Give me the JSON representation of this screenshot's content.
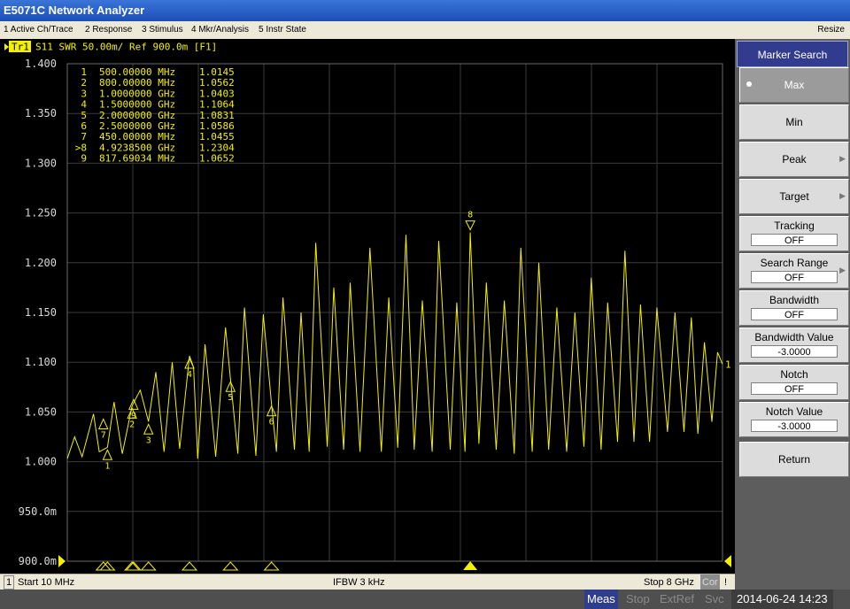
{
  "window": {
    "title": "E5071C Network Analyzer",
    "resize_label": "Resize"
  },
  "menu": [
    "1 Active Ch/Trace",
    "2 Response",
    "3 Stimulus",
    "4 Mkr/Analysis",
    "5 Instr State"
  ],
  "trace": {
    "badge": "Tr1",
    "header": "S11  SWR 50.00m/ Ref 900.0m [F1]",
    "color": "#f4f000",
    "ref_value": 0.9,
    "ref_end_label": "1"
  },
  "chart_data": {
    "type": "line",
    "x_range_mhz": [
      10,
      8000
    ],
    "ylim": [
      0.9,
      1.4
    ],
    "y_ticks": [
      {
        "value": 1.4,
        "label": "1.400"
      },
      {
        "value": 1.35,
        "label": "1.350"
      },
      {
        "value": 1.3,
        "label": "1.300"
      },
      {
        "value": 1.25,
        "label": "1.250"
      },
      {
        "value": 1.2,
        "label": "1.200"
      },
      {
        "value": 1.15,
        "label": "1.150"
      },
      {
        "value": 1.1,
        "label": "1.100"
      },
      {
        "value": 1.05,
        "label": "1.050"
      },
      {
        "value": 1.0,
        "label": "1.000"
      },
      {
        "value": 0.95,
        "label": "950.0m"
      },
      {
        "value": 0.9,
        "label": "900.0m"
      }
    ],
    "grid": true,
    "x_divisions": 10,
    "series": [
      {
        "values_approx": [
          [
            10,
            1.003
          ],
          [
            100,
            1.025
          ],
          [
            190,
            1.005
          ],
          [
            330,
            1.048
          ],
          [
            400,
            1.01
          ],
          [
            500,
            1.0145
          ],
          [
            580,
            1.06
          ],
          [
            680,
            1.008
          ],
          [
            800,
            1.0562
          ],
          [
            900,
            1.072
          ],
          [
            1000,
            1.0403
          ],
          [
            1090,
            1.09
          ],
          [
            1190,
            1.01
          ],
          [
            1290,
            1.1
          ],
          [
            1380,
            1.013
          ],
          [
            1500,
            1.1064
          ],
          [
            1550,
            1.095
          ],
          [
            1600,
            1.003
          ],
          [
            1690,
            1.118
          ],
          [
            1820,
            1.005
          ],
          [
            1940,
            1.135
          ],
          [
            2000,
            1.0831
          ],
          [
            2090,
            1.008
          ],
          [
            2170,
            1.155
          ],
          [
            2310,
            1.006
          ],
          [
            2400,
            1.148
          ],
          [
            2500,
            1.0586
          ],
          [
            2560,
            1.01
          ],
          [
            2640,
            1.165
          ],
          [
            2780,
            1.012
          ],
          [
            2860,
            1.15
          ],
          [
            2960,
            1.01
          ],
          [
            3040,
            1.22
          ],
          [
            3180,
            1.015
          ],
          [
            3260,
            1.175
          ],
          [
            3380,
            1.012
          ],
          [
            3460,
            1.18
          ],
          [
            3580,
            1.01
          ],
          [
            3700,
            1.215
          ],
          [
            3840,
            1.01
          ],
          [
            3930,
            1.165
          ],
          [
            4040,
            1.014
          ],
          [
            4140,
            1.228
          ],
          [
            4240,
            1.012
          ],
          [
            4340,
            1.162
          ],
          [
            4460,
            1.01
          ],
          [
            4540,
            1.222
          ],
          [
            4680,
            1.012
          ],
          [
            4760,
            1.16
          ],
          [
            4860,
            1.01
          ],
          [
            4924,
            1.2304
          ],
          [
            5030,
            1.018
          ],
          [
            5120,
            1.18
          ],
          [
            5240,
            1.012
          ],
          [
            5340,
            1.162
          ],
          [
            5460,
            1.008
          ],
          [
            5540,
            1.215
          ],
          [
            5680,
            1.01
          ],
          [
            5760,
            1.2
          ],
          [
            5880,
            1.012
          ],
          [
            5980,
            1.155
          ],
          [
            6100,
            1.01
          ],
          [
            6200,
            1.15
          ],
          [
            6310,
            1.015
          ],
          [
            6400,
            1.185
          ],
          [
            6520,
            1.012
          ],
          [
            6600,
            1.16
          ],
          [
            6720,
            1.02
          ],
          [
            6810,
            1.212
          ],
          [
            6920,
            1.02
          ],
          [
            7000,
            1.158
          ],
          [
            7110,
            1.02
          ],
          [
            7200,
            1.155
          ],
          [
            7330,
            1.03
          ],
          [
            7420,
            1.15
          ],
          [
            7530,
            1.03
          ],
          [
            7620,
            1.145
          ],
          [
            7700,
            1.028
          ],
          [
            7780,
            1.12
          ],
          [
            7870,
            1.04
          ],
          [
            7940,
            1.11
          ],
          [
            8000,
            1.098
          ]
        ]
      }
    ],
    "markers": [
      {
        "id": "1",
        "label": "1",
        "freq": "500.00000 MHz",
        "mhz": 500,
        "value": 1.0145,
        "val_text": "1.0145",
        "active": false
      },
      {
        "id": "2",
        "label": "2",
        "freq": "800.00000 MHz",
        "mhz": 800,
        "value": 1.0562,
        "val_text": "1.0562",
        "active": false
      },
      {
        "id": "3",
        "label": "3",
        "freq": "1.0000000 GHz",
        "mhz": 1000,
        "value": 1.0403,
        "val_text": "1.0403",
        "active": false
      },
      {
        "id": "4",
        "label": "4",
        "freq": "1.5000000 GHz",
        "mhz": 1500,
        "value": 1.1064,
        "val_text": "1.1064",
        "active": false
      },
      {
        "id": "5",
        "label": "5",
        "freq": "2.0000000 GHz",
        "mhz": 2000,
        "value": 1.0831,
        "val_text": "1.0831",
        "active": false
      },
      {
        "id": "6",
        "label": "6",
        "freq": "2.5000000 GHz",
        "mhz": 2500,
        "value": 1.0586,
        "val_text": "1.0586",
        "active": false
      },
      {
        "id": "7",
        "label": "7",
        "freq": "450.00000 MHz",
        "mhz": 450,
        "value": 1.0455,
        "val_text": "1.0455",
        "active": false
      },
      {
        "id": "8",
        "label": ">8",
        "freq": "4.9238500 GHz",
        "mhz": 4924,
        "value": 1.2304,
        "val_text": "1.2304",
        "active": true
      },
      {
        "id": "9",
        "label": "9",
        "freq": "817.69034 MHz",
        "mhz": 818,
        "value": 1.0652,
        "val_text": "1.0652",
        "active": false
      }
    ]
  },
  "softkeys": {
    "title": "Marker Search",
    "max": "Max",
    "min": "Min",
    "peak": "Peak",
    "target": "Target",
    "tracking": "Tracking",
    "tracking_value": "OFF",
    "search_range": "Search Range",
    "search_range_value": "OFF",
    "bandwidth": "Bandwidth",
    "bandwidth_value": "OFF",
    "bandwidth_value_label": "Bandwidth Value",
    "bandwidth_value_value": "-3.0000",
    "notch": "Notch",
    "notch_value": "OFF",
    "notch_value_label": "Notch Value",
    "notch_value_value": "-3.0000",
    "return": "Return"
  },
  "status": {
    "channel": "1",
    "start": "Start 10 MHz",
    "ifbw": "IFBW 3 kHz",
    "stop": "Stop 8 GHz",
    "cor": "Cor",
    "excl": "!",
    "meas": "Meas",
    "stop_ind": "Stop",
    "extref": "ExtRef",
    "svc": "Svc",
    "datetime": "2014-06-24 14:23"
  }
}
